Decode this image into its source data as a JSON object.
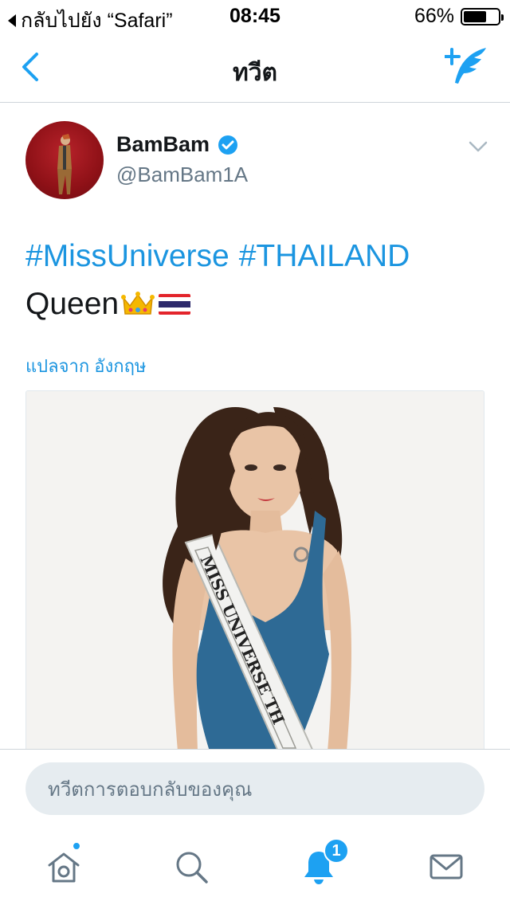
{
  "status_bar": {
    "back_label": "กลับไปยัง “Safari”",
    "time": "08:45",
    "battery_percent_label": "66%",
    "battery_level": 0.66
  },
  "nav": {
    "title": "ทวีต"
  },
  "tweet": {
    "user_name": "BamBam",
    "user_handle": "@BamBam1A",
    "verified": true,
    "hashtags": [
      "#MissUniverse",
      "#THAILAND"
    ],
    "body_text": "Queen",
    "translate_label": "แปลจาก อังกฤษ"
  },
  "reply": {
    "placeholder": "ทวีตการตอบกลับของคุณ"
  },
  "tab_bar": {
    "notification_badge": "1"
  },
  "colors": {
    "accent": "#1da1f2",
    "link": "#1b95e0",
    "text": "#14171a",
    "secondary_text": "#657786"
  }
}
